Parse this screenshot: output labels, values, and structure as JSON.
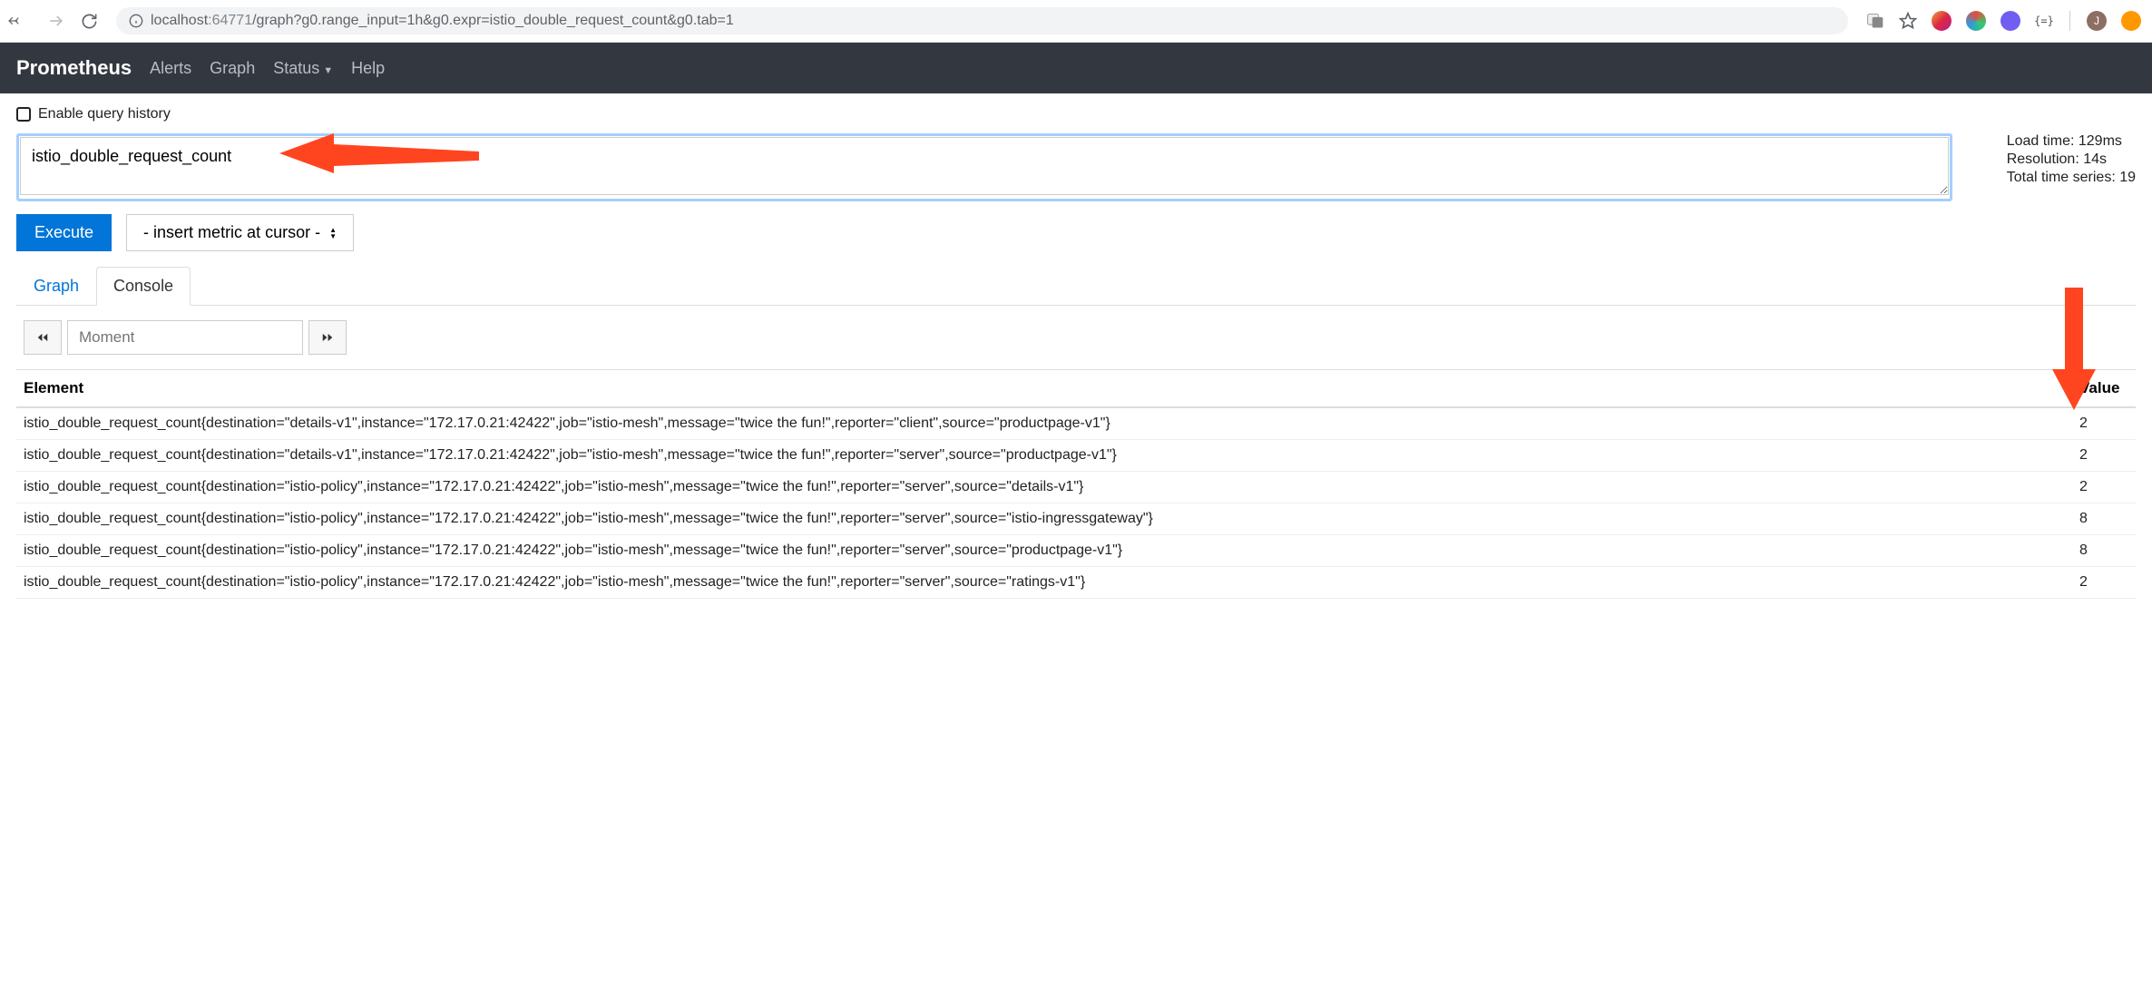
{
  "browser": {
    "url_prefix": "localhost",
    "url_port": ":64771",
    "url_path": "/graph?g0.range_input=1h&g0.expr=istio_double_request_count&g0.tab=1"
  },
  "navbar": {
    "brand": "Prometheus",
    "links": {
      "alerts": "Alerts",
      "graph": "Graph",
      "status": "Status",
      "help": "Help"
    }
  },
  "query_history_label": "Enable query history",
  "expression": "istio_double_request_count",
  "execute_label": "Execute",
  "metric_select_label": "- insert metric at cursor -",
  "stats": {
    "load_time": "Load time: 129ms",
    "resolution": "Resolution: 14s",
    "total_series": "Total time series: 19"
  },
  "tabs": {
    "graph": "Graph",
    "console": "Console"
  },
  "moment_placeholder": "Moment",
  "table": {
    "headers": {
      "element": "Element",
      "value": "Value"
    },
    "rows": [
      {
        "element": "istio_double_request_count{destination=\"details-v1\",instance=\"172.17.0.21:42422\",job=\"istio-mesh\",message=\"twice the fun!\",reporter=\"client\",source=\"productpage-v1\"}",
        "value": "2"
      },
      {
        "element": "istio_double_request_count{destination=\"details-v1\",instance=\"172.17.0.21:42422\",job=\"istio-mesh\",message=\"twice the fun!\",reporter=\"server\",source=\"productpage-v1\"}",
        "value": "2"
      },
      {
        "element": "istio_double_request_count{destination=\"istio-policy\",instance=\"172.17.0.21:42422\",job=\"istio-mesh\",message=\"twice the fun!\",reporter=\"server\",source=\"details-v1\"}",
        "value": "2"
      },
      {
        "element": "istio_double_request_count{destination=\"istio-policy\",instance=\"172.17.0.21:42422\",job=\"istio-mesh\",message=\"twice the fun!\",reporter=\"server\",source=\"istio-ingressgateway\"}",
        "value": "8"
      },
      {
        "element": "istio_double_request_count{destination=\"istio-policy\",instance=\"172.17.0.21:42422\",job=\"istio-mesh\",message=\"twice the fun!\",reporter=\"server\",source=\"productpage-v1\"}",
        "value": "8"
      },
      {
        "element": "istio_double_request_count{destination=\"istio-policy\",instance=\"172.17.0.21:42422\",job=\"istio-mesh\",message=\"twice the fun!\",reporter=\"server\",source=\"ratings-v1\"}",
        "value": "2"
      }
    ]
  }
}
